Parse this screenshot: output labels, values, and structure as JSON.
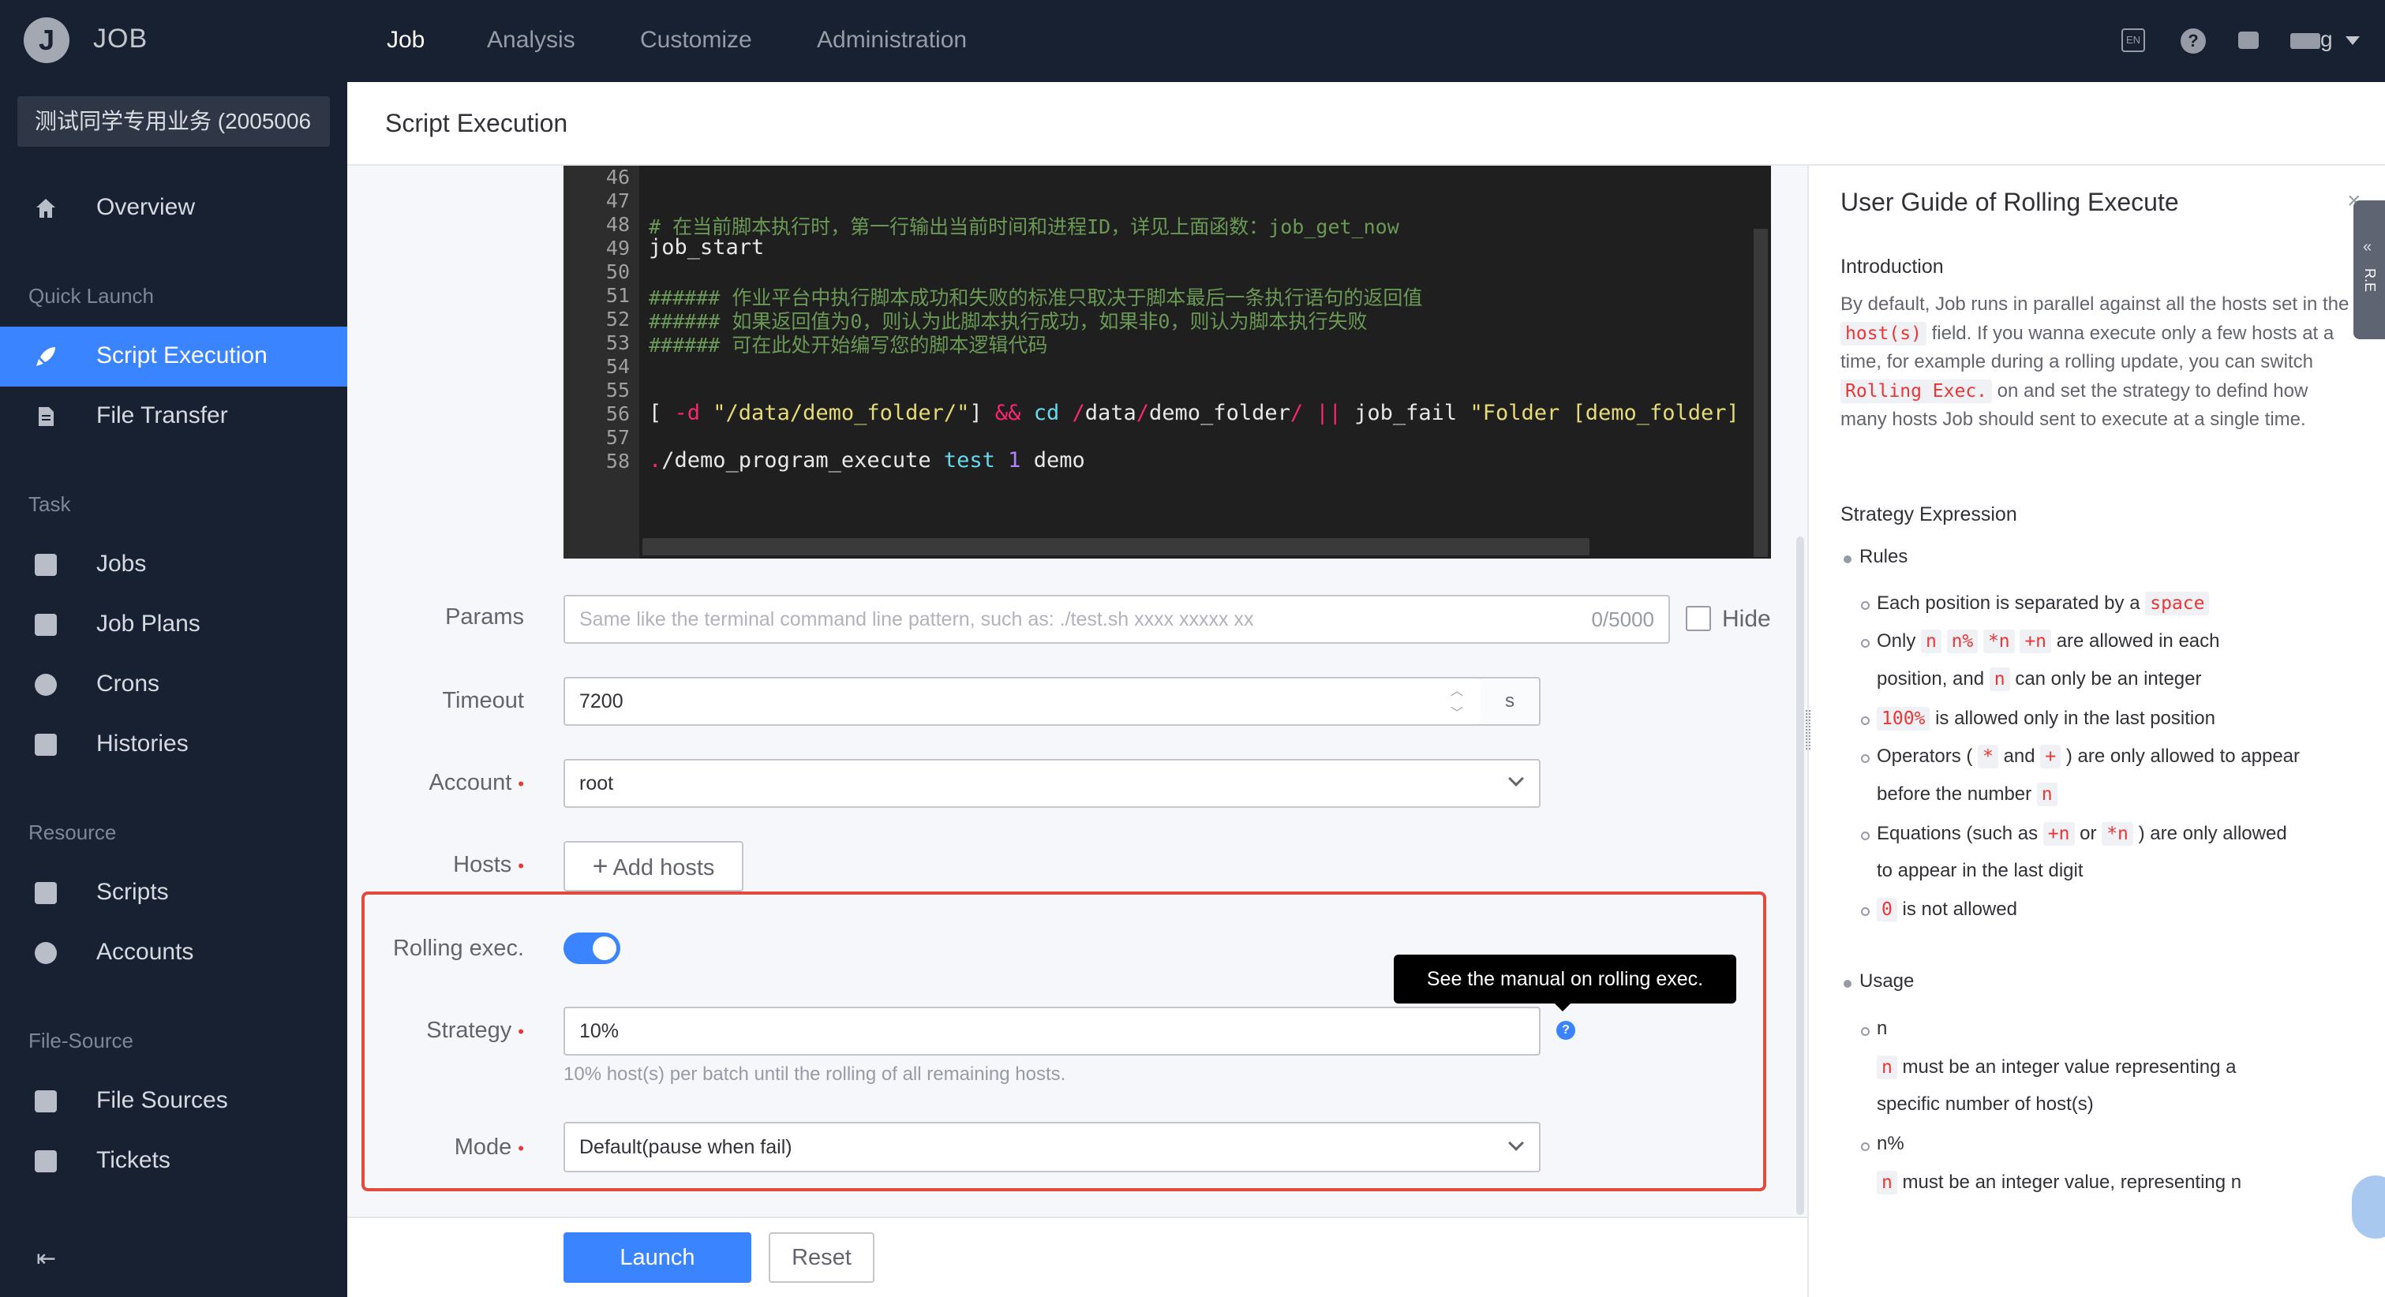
{
  "app": {
    "logo_letter": "J",
    "name": "JOB"
  },
  "topnav": {
    "items": [
      "Job",
      "Analysis",
      "Customize",
      "Administration"
    ],
    "lang_badge": "EN",
    "user": "g"
  },
  "sidebar": {
    "business": "测试同学专用业务 (2005006",
    "groups": {
      "quick_launch": "Quick Launch",
      "task": "Task",
      "resource": "Resource",
      "file_source": "File-Source"
    },
    "items": {
      "overview": "Overview",
      "script_execution": "Script Execution",
      "file_transfer": "File Transfer",
      "jobs": "Jobs",
      "job_plans": "Job Plans",
      "crons": "Crons",
      "histories": "Histories",
      "scripts": "Scripts",
      "accounts": "Accounts",
      "file_sources": "File Sources",
      "tickets": "Tickets"
    }
  },
  "page": {
    "title": "Script Execution"
  },
  "editor": {
    "line_numbers": [
      "46",
      "47",
      "48",
      "49",
      "50",
      "51",
      "52",
      "53",
      "54",
      "55",
      "56",
      "57",
      "58"
    ],
    "line48": "# 在当前脚本执行时，第一行输出当前时间和进程ID，详见上面函数：job_get_now",
    "line49": "job_start",
    "line51": "###### 作业平台中执行脚本成功和失败的标准只取决于脚本最后一条执行语句的返回值",
    "line52": "###### 如果返回值为0，则认为此脚本执行成功，如果非0，则认为脚本执行失败",
    "line53": "###### 可在此处开始编写您的脚本逻辑代码",
    "line56": {
      "a": "[ ",
      "b": "-d",
      "c": " \"/data/demo_folder/\"",
      "d": "] ",
      "e": "&&",
      "f": " cd ",
      "g": "/",
      "h": "data",
      "i": "/",
      "j": "demo_folder",
      "k": "/ ",
      "l": "||",
      "m": " job_fail ",
      "n": "\"Folder [demo_folder]"
    },
    "line58": {
      "a": ".",
      "b": "/demo_program_execute ",
      "c": "test",
      "d": " 1 ",
      "e": "demo"
    }
  },
  "form": {
    "params_label": "Params",
    "params_placeholder": "Same like the terminal command line pattern, such as: ./test.sh xxxx xxxxx xx",
    "params_counter": "0/5000",
    "hide_label": "Hide",
    "timeout_label": "Timeout",
    "timeout_value": "7200",
    "timeout_unit": "s",
    "account_label": "Account",
    "account_value": "root",
    "hosts_label": "Hosts",
    "add_hosts": "Add hosts",
    "rolling_label": "Rolling exec.",
    "rolling_enabled": true,
    "strategy_label": "Strategy",
    "strategy_value": "10%",
    "strategy_help": "10% host(s) per batch until the rolling of all remaining hosts.",
    "tooltip": "See the manual on rolling exec.",
    "mode_label": "Mode",
    "mode_value": "Default(pause when fail)",
    "required_mark": "•"
  },
  "actions": {
    "launch": "Launch",
    "reset": "Reset"
  },
  "guide": {
    "title": "User Guide of Rolling Execute",
    "close": "×",
    "tab_label": "R.E",
    "intro_heading": "Introduction",
    "intro": {
      "t1": "By default, Job runs in parallel against all the hosts set in the ",
      "c1": "host(s)",
      "t2": " field. If you wanna execute only a few hosts at a time, for example during a rolling update, you can switch ",
      "c2": "Rolling Exec.",
      "t3": " on and set the strategy to defind how many hosts Job should sent to execute at a single time."
    },
    "strategy_heading": "Strategy Expression",
    "rules_heading": "Rules",
    "rules": {
      "r1_text": "Each position is separated by a",
      "r1_code": "space",
      "r2_a": "Only",
      "r2_c1": "n",
      "r2_c2": "n%",
      "r2_c3": "*n",
      "r2_c4": "+n",
      "r2_b": "are allowed in each",
      "r2_line2a": "position, and",
      "r2_c5": "n",
      "r2_line2b": "can only be an integer",
      "r3_code": "100%",
      "r3_text": "is allowed only in the last position",
      "r4_a": "Operators (",
      "r4_c1": "*",
      "r4_b": "and",
      "r4_c2": "+",
      "r4_c": ") are only allowed to appear",
      "r4_line2": "before the number",
      "r4_c3": "n",
      "r5_a": "Equations (such as",
      "r5_c1": "+n",
      "r5_b": "or",
      "r5_c2": "*n",
      "r5_c": ") are only allowed",
      "r5_line2": "to appear in the last digit",
      "r6_code": "0",
      "r6_text": "is not allowed"
    },
    "usage_heading": "Usage",
    "usage": {
      "u1_title": "n",
      "u1_code": "n",
      "u1_text": "must be an integer value representing a",
      "u1_line2": "specific number of host(s)",
      "u2_title": "n%",
      "u2_code": "n",
      "u2_text": "must be an integer value, representing n"
    }
  }
}
